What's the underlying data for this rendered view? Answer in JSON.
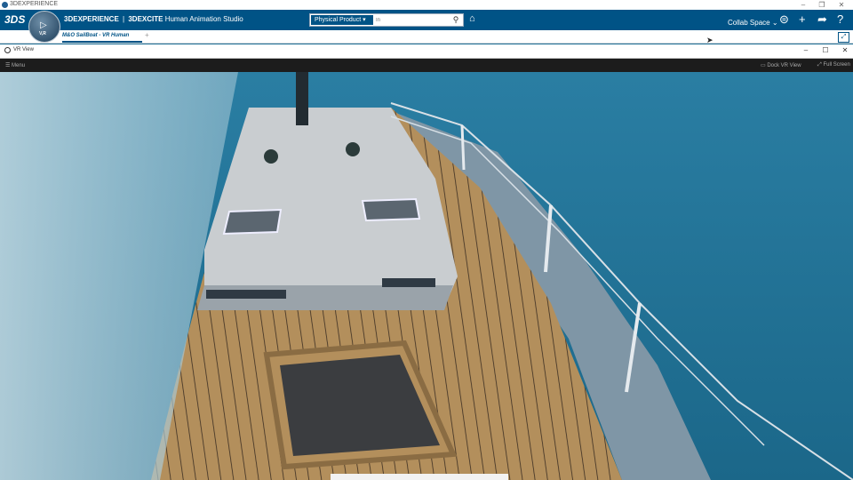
{
  "window": {
    "os_title": "3DEXPERIENCE",
    "controls": [
      "–",
      "❐",
      "✕"
    ]
  },
  "topbar": {
    "logo": "3DS",
    "compass_vr": "V,R",
    "brand_3dx": "3DEXPERIENCE",
    "brand_sep": "|",
    "brand_app": "3DEXCITE",
    "brand_title": "Human Animation Studio",
    "search_scope": "Physical Product",
    "search_placeholder": "In",
    "collab_space": "Collab Space"
  },
  "tabs": [
    {
      "label": "M&O SailBoat - VR Human"
    }
  ],
  "tab_add": "+",
  "vr_window": {
    "title": "VR View",
    "menu": "Menu",
    "dock": "Dock VR View",
    "fullscreen": "Full Screen",
    "controls": [
      "–",
      "☐",
      "✕"
    ]
  },
  "colors": {
    "top_blue": "#005386",
    "sea": "#1e6f94",
    "deck_wood": "#b08d5a",
    "cabin_white": "#d9dcdf"
  },
  "icons": [
    "ds-logo-icon",
    "compass-icon",
    "search-icon",
    "tag-icon",
    "user-icon",
    "add-icon",
    "share-icon",
    "help-icon",
    "expand-icon",
    "window-icon",
    "menu-icon"
  ]
}
